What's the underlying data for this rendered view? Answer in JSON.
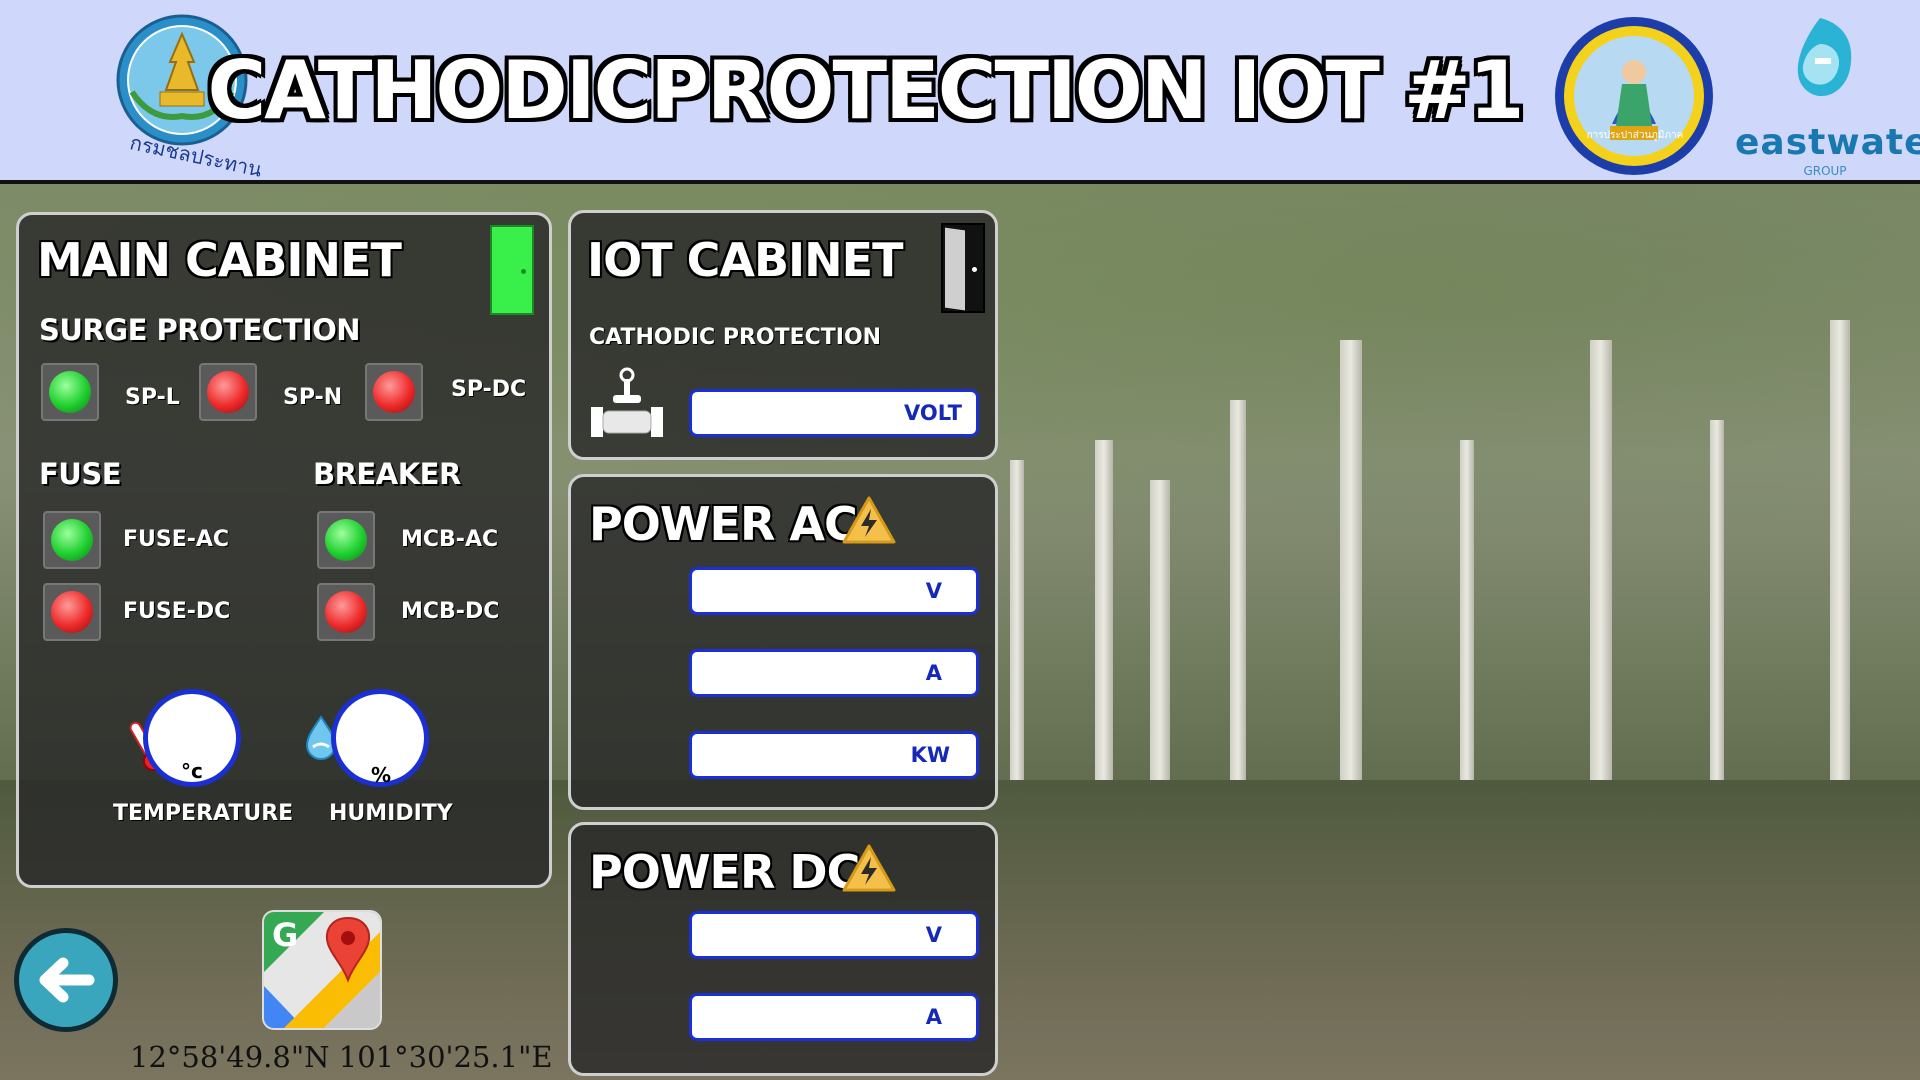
{
  "header": {
    "title": "CATHODICPROTECTION IOT #1",
    "logo_left_text": "กรมชลประทาน",
    "logo_right_text": "eastwater",
    "logo_right_sub": "GROUP",
    "badge_text": "การประปาส่วนภูมิภาค"
  },
  "main_cabinet": {
    "title": "MAIN CABINET",
    "door_status": "open",
    "surge_title": "SURGE PROTECTION",
    "surge": [
      {
        "label": "SP-L",
        "state": "green"
      },
      {
        "label": "SP-N",
        "state": "red"
      },
      {
        "label": "SP-DC",
        "state": "red"
      }
    ],
    "fuse_title": "FUSE",
    "fuses": [
      {
        "label": "FUSE-AC",
        "state": "green"
      },
      {
        "label": "FUSE-DC",
        "state": "red"
      }
    ],
    "breaker_title": "BREAKER",
    "breakers": [
      {
        "label": "MCB-AC",
        "state": "green"
      },
      {
        "label": "MCB-DC",
        "state": "red"
      }
    ],
    "temperature": {
      "label": "TEMPERATURE",
      "unit": "°c",
      "value": ""
    },
    "humidity": {
      "label": "HUMIDITY",
      "unit": "%",
      "value": ""
    }
  },
  "iot_cabinet": {
    "title": "IOT CABINET",
    "door_status": "closed",
    "cathodic_label": "CATHODIC PROTECTION",
    "cathodic_unit": "VOLT",
    "cathodic_value": ""
  },
  "power_ac": {
    "title": "POWER AC",
    "fields": [
      {
        "unit": "V",
        "value": ""
      },
      {
        "unit": "A",
        "value": ""
      },
      {
        "unit": "KW",
        "value": ""
      }
    ]
  },
  "power_dc": {
    "title": "POWER DC",
    "fields": [
      {
        "unit": "V",
        "value": ""
      },
      {
        "unit": "A",
        "value": ""
      }
    ]
  },
  "footer": {
    "coordinates": "12°58'49.8\"N 101°30'25.1\"E"
  },
  "colors": {
    "header_bg": "#cfd8fb",
    "led_green": "#1fcf2f",
    "led_red": "#ee2a2a",
    "field_border": "#1a2fd6",
    "door_open": "#39f04a"
  },
  "icons": [
    "back-arrow-icon",
    "google-maps-icon",
    "thermometer-icon",
    "humidity-icon",
    "warning-bolt-icon",
    "pipe-valve-icon",
    "door-icon"
  ]
}
